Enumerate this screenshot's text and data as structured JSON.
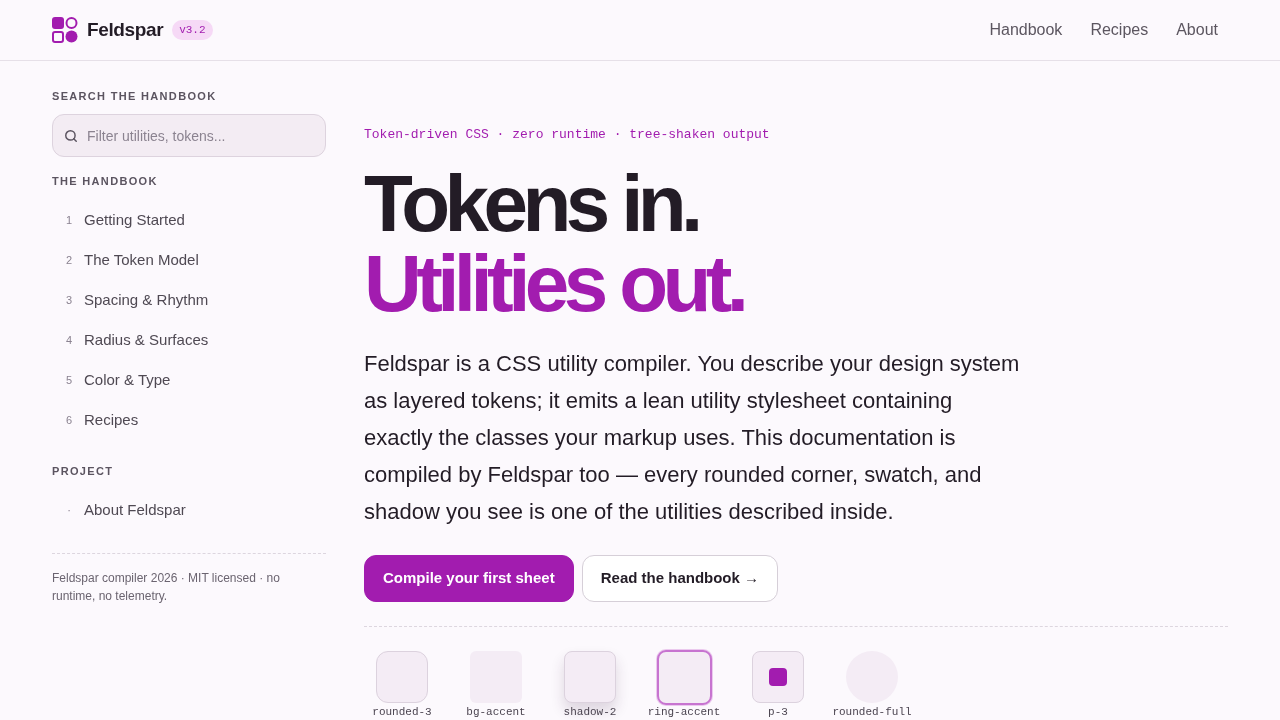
{
  "header": {
    "brand": "Feldspar",
    "version": "v3.2",
    "nav": [
      "Handbook",
      "Recipes",
      "About"
    ]
  },
  "sidebar": {
    "search": {
      "heading": "SEARCH THE HANDBOOK",
      "placeholder": "Filter utilities, tokens..."
    },
    "sections": [
      {
        "heading": "THE HANDBOOK",
        "items": [
          {
            "marker": "1",
            "label": "Getting Started"
          },
          {
            "marker": "2",
            "label": "The Token Model"
          },
          {
            "marker": "3",
            "label": "Spacing & Rhythm"
          },
          {
            "marker": "4",
            "label": "Radius & Surfaces"
          },
          {
            "marker": "5",
            "label": "Color & Type"
          },
          {
            "marker": "6",
            "label": "Recipes"
          }
        ]
      },
      {
        "heading": "PROJECT",
        "items": [
          {
            "marker": "·",
            "label": "About Feldspar"
          }
        ]
      }
    ],
    "footer": "Feldspar compiler 2026 · MIT licensed · no runtime, no telemetry."
  },
  "hero": {
    "eyebrow": "Token-driven CSS · zero runtime · tree-shaken output",
    "headline": [
      {
        "text": "Tokens in.",
        "accent": false
      },
      {
        "text": "Utilities out.",
        "accent": true
      }
    ],
    "description": "Feldspar is a CSS utility compiler. You describe your design system as layered tokens; it emits a lean utility stylesheet containing exactly the classes your markup uses. This documentation is compiled by Feldspar too — every rounded corner, swatch, and shadow you see is one of the utilities described inside.",
    "buttons": [
      {
        "label": "Compile your first sheet",
        "kind": "primary"
      },
      {
        "label": "Read the handbook →",
        "kind": "secondary"
      }
    ],
    "swatches": [
      {
        "label": "rounded-3",
        "kind": "rounded"
      },
      {
        "label": "bg-accent",
        "kind": "fill"
      },
      {
        "label": "shadow-2",
        "kind": "shadow"
      },
      {
        "label": "ring-accent",
        "kind": "ring"
      },
      {
        "label": "p-3",
        "kind": "padding"
      },
      {
        "label": "rounded-full",
        "kind": "circle"
      }
    ]
  }
}
